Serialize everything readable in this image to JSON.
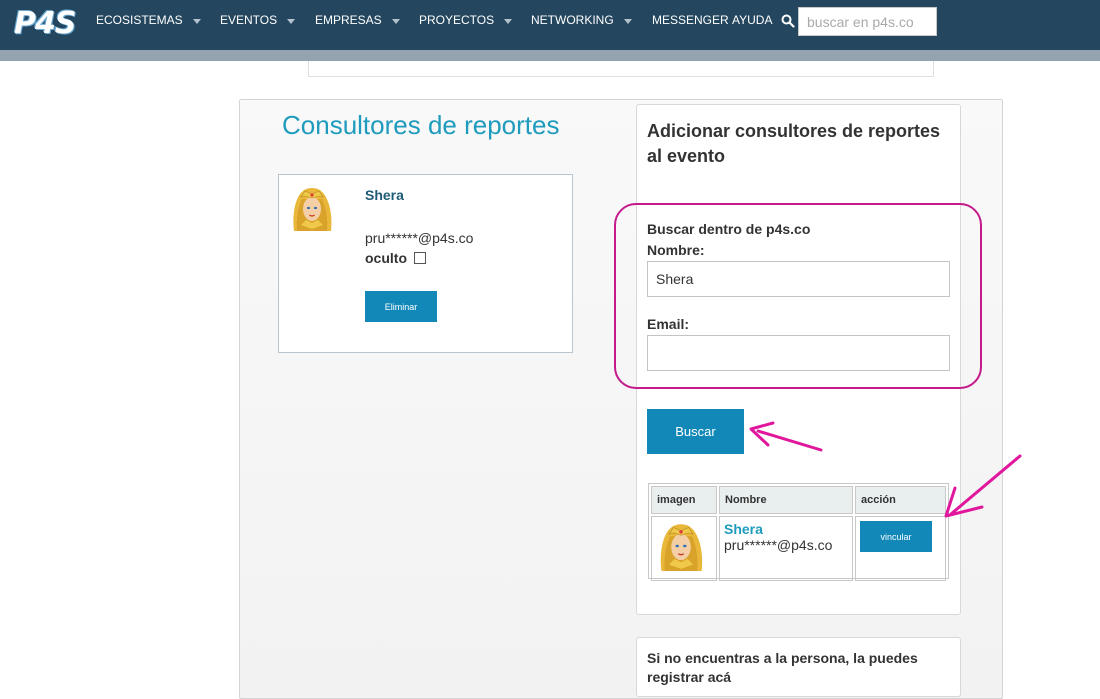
{
  "nav": {
    "logo": "P4S",
    "items": [
      "ECOSISTEMAS",
      "EVENTOS",
      "EMPRESAS",
      "PROYECTOS",
      "NETWORKING"
    ],
    "messenger": "MESSENGER",
    "ayuda": "AYUDA",
    "search_placeholder": "buscar en p4s.co"
  },
  "left": {
    "title": "Consultores de reportes",
    "consultant": {
      "name": "Shera",
      "email": "pru******@p4s.co",
      "hidden_label": "oculto",
      "hidden_checked": false,
      "delete_label": "Eliminar"
    }
  },
  "right": {
    "title": "Adicionar consultores de reportes al evento",
    "search_label": "Buscar dentro de p4s.co",
    "name_label": "Nombre:",
    "name_value": "Shera",
    "email_label": "Email:",
    "email_value": "",
    "search_button": "Buscar",
    "results": {
      "headers": [
        "imagen",
        "Nombre",
        "acción"
      ],
      "rows": [
        {
          "name": "Shera",
          "email": "pru******@p4s.co",
          "action": "vincular"
        }
      ]
    }
  },
  "footer_panel": {
    "text": "Si no encuentras a la persona, la puedes registrar acá"
  },
  "colors": {
    "nav_bg": "#24475f",
    "accent": "#1188b8",
    "title": "#1f9bbd",
    "annotation": "#e0179c"
  }
}
